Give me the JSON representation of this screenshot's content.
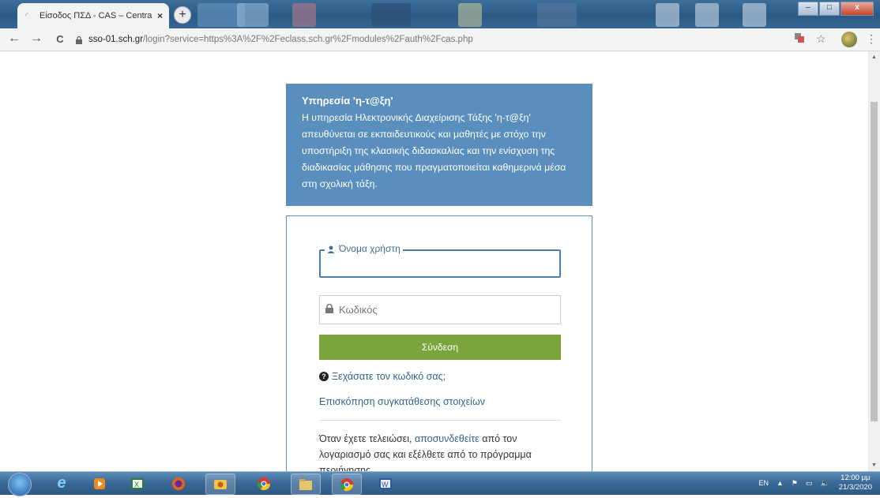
{
  "browser": {
    "tab_title": "Είσοδος ΠΣΔ - CAS – Central Aut",
    "tab_close": "×",
    "new_tab": "+",
    "url_host": "sso-01.sch.gr",
    "url_path": "/login?service=https%3A%2F%2Feclass.sch.gr%2Fmodules%2Fauth%2Fcas.php",
    "back": "←",
    "forward": "→",
    "reload": "C",
    "star": "☆",
    "menu": "⋮",
    "min": "–",
    "max": "□",
    "close": "x"
  },
  "info": {
    "title": "Υπηρεσία 'η-τ@ξη'",
    "body": "Η υπηρεσία Ηλεκτρονικής Διαχείρισης Τάξης 'η-τ@ξη' απευθύνεται σε εκπαιδευτικούς και μαθητές με στόχο την υποστήριξη της κλασικής διδασκαλίας και την ενίσχυση της διαδικασίας μάθησης που πραγματοποιείται καθημερινά μέσα στη σχολική τάξη."
  },
  "login": {
    "username_label": "Όνομα χρήστη",
    "password_placeholder": "Κωδικός",
    "submit": "Σύνδεση",
    "forgot": "Ξεχάσατε τον κωδικό σας;",
    "consent": "Επισκόπηση συγκατάθεσης στοιχείων",
    "logout_before": "Όταν έχετε τελειώσει, ",
    "logout_link": "αποσυνδεθείτε",
    "logout_after": " από τον λογαριασμό σας και εξέλθετε από το πρόγραμμα περιήγησης"
  },
  "taskbar": {
    "lang": "EN",
    "time": "12:00 μμ",
    "date": "21/3/2020"
  },
  "colors": {
    "info_bg": "#5a8ebd",
    "button_bg": "#7aa53c",
    "link": "#2f6490"
  }
}
